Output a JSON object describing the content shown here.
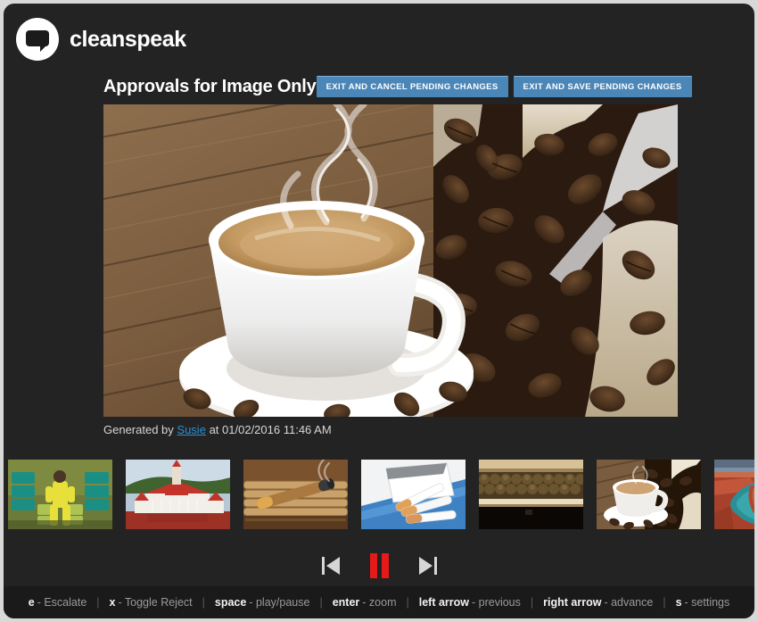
{
  "brand": {
    "name": "cleanspeak",
    "logo_icon": "speech-bubble-icon"
  },
  "header": {
    "title": "Approvals for Image Only",
    "buttons": [
      {
        "label": "EXIT AND CANCEL PENDING CHANGES",
        "name": "exit-cancel-pending-changes-button"
      },
      {
        "label": "EXIT AND SAVE PENDING CHANGES",
        "name": "exit-save-pending-changes-button"
      }
    ],
    "button_color": "#4a86b8"
  },
  "main_image": {
    "alt": "White cup of hot coffee with steam on rustic wooden table beside roasted coffee beans spilling from burlap sack with metal scoop"
  },
  "caption": {
    "prefix": "Generated by",
    "user": "Susie",
    "middle": "at",
    "timestamp": "01/02/2016 11:46 AM",
    "link_color": "#2d8fd5"
  },
  "thumbnails": [
    {
      "alt": "Person in yellow hazmat suit seated among teal barrels and money stacks"
    },
    {
      "alt": "Red and white colonial temple building beside water with green hills"
    },
    {
      "alt": "Lit cigar resting on wooden cigar box with rolled cigars"
    },
    {
      "alt": "Loose cigarettes spilling from an open white pack on blue surface"
    },
    {
      "alt": "Rows of stacked rolled cigars on a lit wooden shelf"
    },
    {
      "alt": "Cup of coffee on saucer with roasted beans spilling from a sack"
    },
    {
      "alt": "Aerial view of red canyon horseshoe bend with turquoise river"
    }
  ],
  "controls": {
    "previous": {
      "label": "Previous",
      "icon": "skip-back-icon"
    },
    "playpause": {
      "label": "Pause",
      "icon": "pause-icon",
      "state": "playing",
      "color": "#e8191a"
    },
    "next": {
      "label": "Advance",
      "icon": "skip-forward-icon"
    }
  },
  "shortcuts": [
    {
      "key": "e",
      "desc": "- Escalate"
    },
    {
      "key": "x",
      "desc": "- Toggle Reject"
    },
    {
      "key": "space",
      "desc": "- play/pause"
    },
    {
      "key": "enter",
      "desc": "- zoom"
    },
    {
      "key": "left arrow",
      "desc": "- previous"
    },
    {
      "key": "right arrow",
      "desc": "- advance"
    },
    {
      "key": "s",
      "desc": "- settings"
    }
  ],
  "separator": "|"
}
